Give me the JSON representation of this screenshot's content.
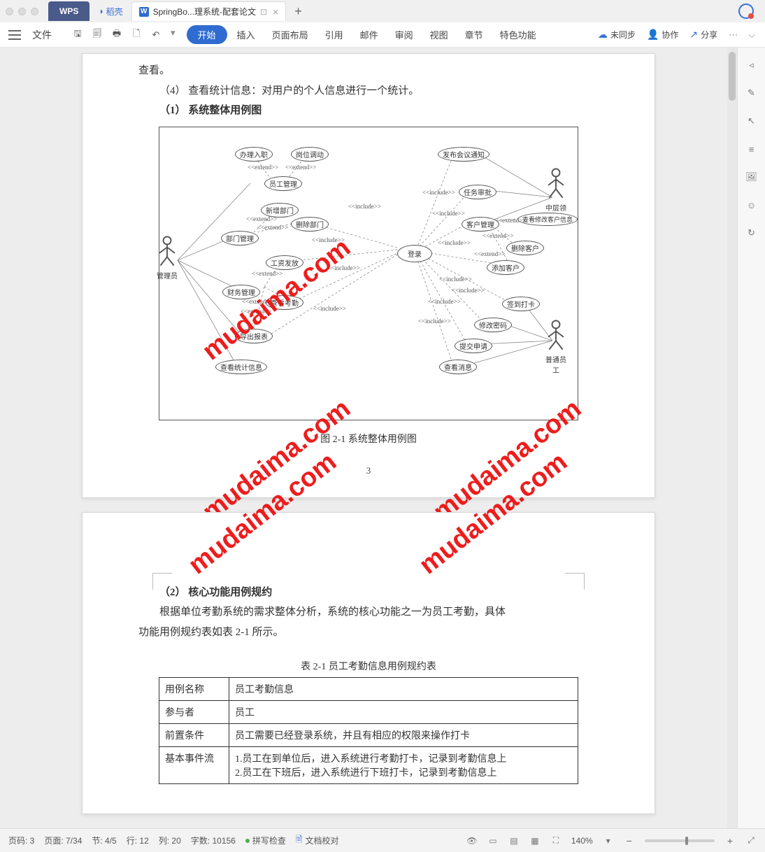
{
  "titlebar": {
    "tabs": {
      "wps": "WPS",
      "daoke": "稻壳",
      "active": "SpringBo...理系统-配套论文"
    }
  },
  "menu": {
    "file": "文件",
    "items": [
      "开始",
      "插入",
      "页面布局",
      "引用",
      "邮件",
      "审阅",
      "视图",
      "章节",
      "特色功能"
    ],
    "actions": {
      "unsync": "未同步",
      "collab": "协作",
      "share": "分享"
    }
  },
  "doc": {
    "p0": "查看。",
    "p1": "（4） 查看统计信息：对用户的个人信息进行一个统计。",
    "h1": "（1） 系统整体用例图",
    "fig_caption": "图 2-1  系统整体用例图",
    "page_num": "3",
    "watermark": "mudaima.com",
    "h2": "（2） 核心功能用例规约",
    "p2a": "根据单位考勤系统的需求整体分析，系统的核心功能之一为员工考勤，具体",
    "p2b": "功能用例规约表如表 2-1 所示。",
    "tbl_caption": "表 2-1  员工考勤信息用例规约表",
    "table": {
      "r1": {
        "h": "用例名称",
        "c": "员工考勤信息"
      },
      "r2": {
        "h": "参与者",
        "c": "员工"
      },
      "r3": {
        "h": "前置条件",
        "c": "员工需要已经登录系统，并且有相应的权限来操作打卡"
      },
      "r4": {
        "h": "基本事件流",
        "c1": "1.员工在到单位后，进入系统进行考勤打卡，记录到考勤信息上",
        "c2": "2.员工在下班后，进入系统进行下班打卡，记录到考勤信息上"
      }
    }
  },
  "diagram": {
    "actors": {
      "admin": "管理员",
      "mid": "中层领导",
      "emp": "普通员工"
    },
    "uc": {
      "banli": "办理入职",
      "gangwei": "岗位调动",
      "ygl": "员工管理",
      "xinzeng": "新增部门",
      "shanchu": "删除部门",
      "bumen": "部门管理",
      "gongzi": "工资发放",
      "caiwu": "财务管理",
      "chakan_kq": "查看考勤",
      "daochu": "导出报表",
      "tongji": "查看统计信息",
      "denglu": "登录",
      "fabu": "发布会议通知",
      "renwu": "任务审批",
      "kehu": "客户管理",
      "chakan_kh": "查看修改客户信息",
      "shanchu_kh": "删除客户",
      "tianjia_kh": "添加客户",
      "qiandao": "签到打卡",
      "xiugai": "修改密码",
      "tijiao": "提交申请",
      "xiaoxi": "查看消息"
    },
    "rel": {
      "ext": "<<extend>>",
      "inc": "<<include>>"
    }
  },
  "status": {
    "page_no": "页码: 3",
    "page": "页面: 7/34",
    "section": "节: 4/5",
    "row": "行: 12",
    "col": "列: 20",
    "words": "字数: 10156",
    "spell": "拼写检查",
    "proof": "文档校对",
    "zoom": "140%"
  }
}
